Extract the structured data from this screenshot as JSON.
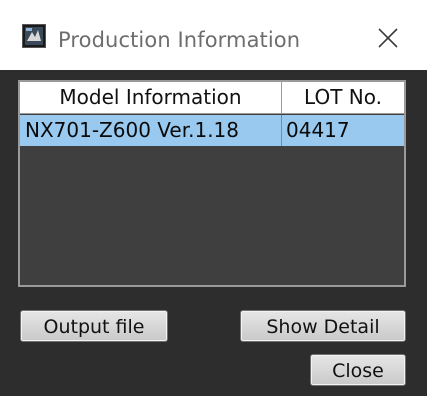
{
  "window": {
    "title": "Production Information",
    "icon": "app-icon",
    "close_icon": "close-icon"
  },
  "table": {
    "columns": [
      "Model Information",
      "LOT No."
    ],
    "rows": [
      {
        "model": "NX701-Z600 Ver.1.18",
        "lot": "04417",
        "selected": true
      }
    ]
  },
  "buttons": {
    "output_file": "Output file",
    "show_detail": "Show Detail",
    "close": "Close"
  },
  "colors": {
    "client_background": "#2d2d2d",
    "list_background": "#3f3f3f",
    "selected_row": "#99c9ef"
  }
}
